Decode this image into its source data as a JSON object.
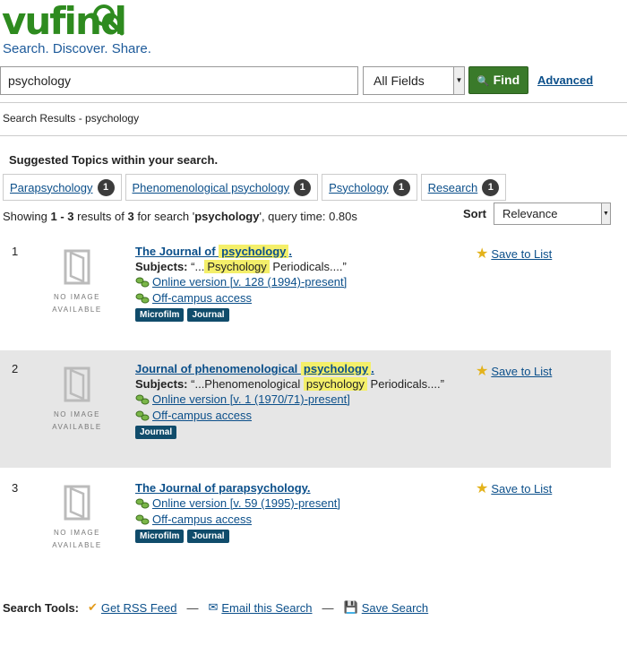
{
  "header": {
    "logo": "vufind",
    "tagline": "Search. Discover. Share."
  },
  "search": {
    "query": "psychology",
    "field": "All Fields",
    "find_label": "Find",
    "advanced_label": "Advanced"
  },
  "breadcrumb": "Search Results - psychology",
  "topics": {
    "title": "Suggested Topics within your search.",
    "items": [
      {
        "label": "Parapsychology",
        "count": "1"
      },
      {
        "label": "Phenomenological psychology",
        "count": "1"
      },
      {
        "label": "Psychology",
        "count": "1"
      },
      {
        "label": "Research",
        "count": "1"
      }
    ]
  },
  "summary": {
    "showing_prefix": "Showing ",
    "range": "1 - 3",
    "results_of": " results of ",
    "total": "3",
    "for_search": " for search '",
    "query": "psychology",
    "query_time": "', query time: 0.80s"
  },
  "sort": {
    "label": "Sort",
    "value": "Relevance"
  },
  "no_image": [
    "NO IMAGE",
    "AVAILABLE"
  ],
  "save_label": "Save to List",
  "subjects_label": "Subjects:",
  "results": [
    {
      "num": "1",
      "title_pre": "The Journal of ",
      "title_hl": "psychology",
      "title_post": ".",
      "subject_pre": "“...",
      "subject_hl": "Psychology",
      "subject_post": " Periodicals....”",
      "online": "Online version [v. 128 (1994)-present]",
      "offcampus": "Off-campus access",
      "formats": [
        "Microfilm",
        "Journal"
      ]
    },
    {
      "num": "2",
      "title_pre": "Journal of phenomenological ",
      "title_hl": "psychology",
      "title_post": ".",
      "subject_pre": "“...Phenomenological ",
      "subject_hl": "psychology",
      "subject_post": " Periodicals....”",
      "online": "Online version [v. 1 (1970/71)-present]",
      "offcampus": "Off-campus access",
      "formats": [
        "Journal"
      ]
    },
    {
      "num": "3",
      "title_pre": "The Journal of parapsychology.",
      "online": "Online version [v. 59 (1995)-present]",
      "offcampus": "Off-campus access",
      "formats": [
        "Microfilm",
        "Journal"
      ]
    }
  ],
  "tools": {
    "label": "Search Tools:",
    "rss": "Get RSS Feed",
    "sep": "—",
    "email": "Email this Search",
    "save": "Save Search"
  }
}
